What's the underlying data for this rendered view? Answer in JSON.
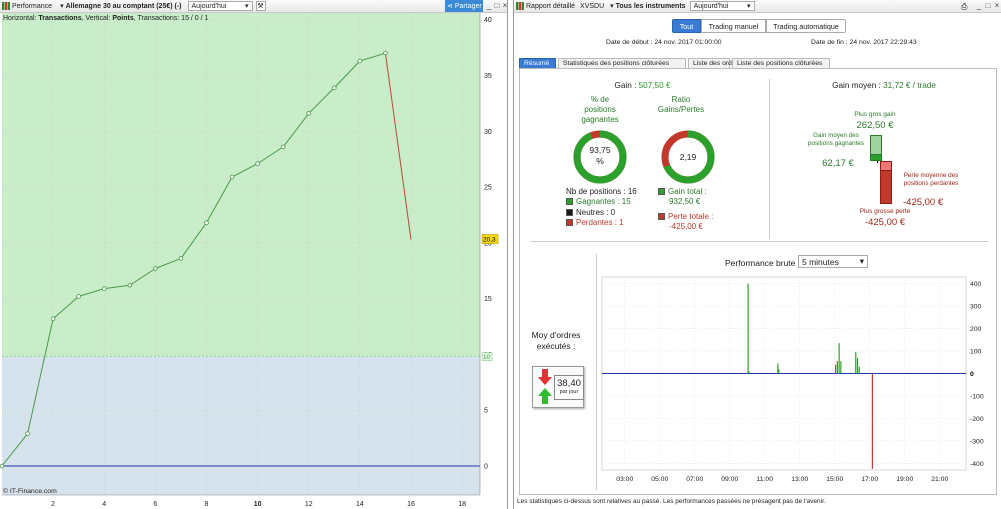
{
  "left": {
    "title": "Performance",
    "instrument": "Allemagne 30 au comptant (25€) (-)",
    "period": "Aujourd'hui",
    "share": "Partager",
    "info_prefix": "Horizontal: ",
    "info_h": "Transactions",
    "info_mid": ", Vertical: ",
    "info_v": "Points",
    "info_tail": ", Transactions: 15 / 0 / 1",
    "credit": "© IT-Finance.com",
    "last_value": "20,3",
    "threshold_label": "10",
    "y_ticks": [
      "40",
      "35",
      "30",
      "25",
      "20",
      "15",
      "10",
      "5",
      "0"
    ],
    "x_ticks": [
      "2",
      "4",
      "6",
      "8",
      "10",
      "12",
      "14",
      "16",
      "18"
    ],
    "x_highlight": "10",
    "chart_data": {
      "type": "line",
      "x": [
        0,
        1,
        2,
        3,
        4,
        5,
        6,
        7,
        8,
        9,
        10,
        11,
        12,
        13,
        14,
        15,
        16
      ],
      "values": [
        0,
        2.9,
        13.2,
        15.2,
        15.9,
        16.2,
        17.7,
        18.6,
        21.8,
        25.9,
        27.1,
        28.6,
        31.6,
        33.9,
        36.3,
        37,
        20.3
      ],
      "xlim": [
        0,
        18.7
      ],
      "ylim": [
        -2.6,
        40.6
      ],
      "threshold": 9.8,
      "last_segment_color": "#b84a3a",
      "line_color": "#4a9a4a"
    }
  },
  "right": {
    "title": "Rapport détaillé",
    "symbol": "XVSDU",
    "instruments": "Tous les instruments",
    "period": "Aujourd'hui",
    "modes": [
      "Tout",
      "Trading manuel",
      "Trading automatique"
    ],
    "date_start": "Date de début : 24 nov. 2017 01:00:00",
    "date_end": "Date de fin : 24 nov. 2017 22:29:43",
    "tabs": [
      "Résumé",
      "Statistiques des positions clôturées",
      "Liste des ordres",
      "Liste des positions clôturées"
    ],
    "gain_label": "Gain : ",
    "gain_value": "507,50 €",
    "pct_title": "% de positions gagnantes",
    "pct_value": "93,75 %",
    "pct_fraction": 0.9375,
    "ratio_title": "Ratio Gains/Pertes",
    "ratio_value": "2,19",
    "ratio_fraction": 0.686,
    "nb_positions": "Nb de positions : 16",
    "gagnantes": "Gagnantes : 15",
    "neutres": "Neutres : 0",
    "perdantes": "Perdantes : 1",
    "gain_total_label": "Gain total :",
    "gain_total_value": "932,50 €",
    "perte_total_label": "Perte totale :",
    "perte_total_value": "-425,00 €",
    "gain_moyen_label": "Gain moyen : ",
    "gain_moyen_value": "31,72 € / trade",
    "plus_gros_gain_label": "Plus gros gain",
    "plus_gros_gain_value": "262,50 €",
    "gain_moyen_pos_label": "Gain moyen des positions gagnantes",
    "gain_moyen_pos_value": "62,17 €",
    "perte_moy_label": "Perte moyenne des positions perdantes",
    "perte_moy_value": "-425,00 €",
    "plus_grosse_perte_label": "Plus grosse perte",
    "plus_grosse_perte_value": "-425,00 €",
    "moy_ordres_label": "Moy d'ordres exécutés :",
    "moy_ordres_value": "38,40",
    "moy_ordres_unit": "par jour",
    "perf_title": "Performance brute",
    "perf_interval": "5 minutes",
    "footer": "Les statistiques ci-dessus sont relatives au passé. Les performances passées ne présagent pas de l'avenir.",
    "colors": {
      "green": "#2ca02c",
      "red": "#c0392b",
      "accent": "#3a7bd5"
    },
    "perf_chart": {
      "type": "bar",
      "y_ticks": [
        "400",
        "300",
        "200",
        "100",
        "0",
        "-100",
        "-200",
        "-300",
        "-400"
      ],
      "x_ticks": [
        "03:00",
        "05:00",
        "07:00",
        "09:00",
        "11:00",
        "13:00",
        "15:00",
        "17:00",
        "19:00",
        "21:00"
      ],
      "ylim": [
        -430,
        430
      ],
      "xlim_hours": [
        1.7,
        22.5
      ],
      "bars": [
        {
          "t": 10.05,
          "v": 400
        },
        {
          "t": 10.1,
          "v": 10
        },
        {
          "t": 11.75,
          "v": 45
        },
        {
          "t": 11.8,
          "v": 20
        },
        {
          "t": 15.05,
          "v": 40
        },
        {
          "t": 15.15,
          "v": 55
        },
        {
          "t": 15.25,
          "v": 135
        },
        {
          "t": 15.35,
          "v": 55
        },
        {
          "t": 16.2,
          "v": 95
        },
        {
          "t": 16.3,
          "v": 70
        },
        {
          "t": 16.4,
          "v": 30
        },
        {
          "t": 17.15,
          "v": -425
        }
      ]
    }
  }
}
